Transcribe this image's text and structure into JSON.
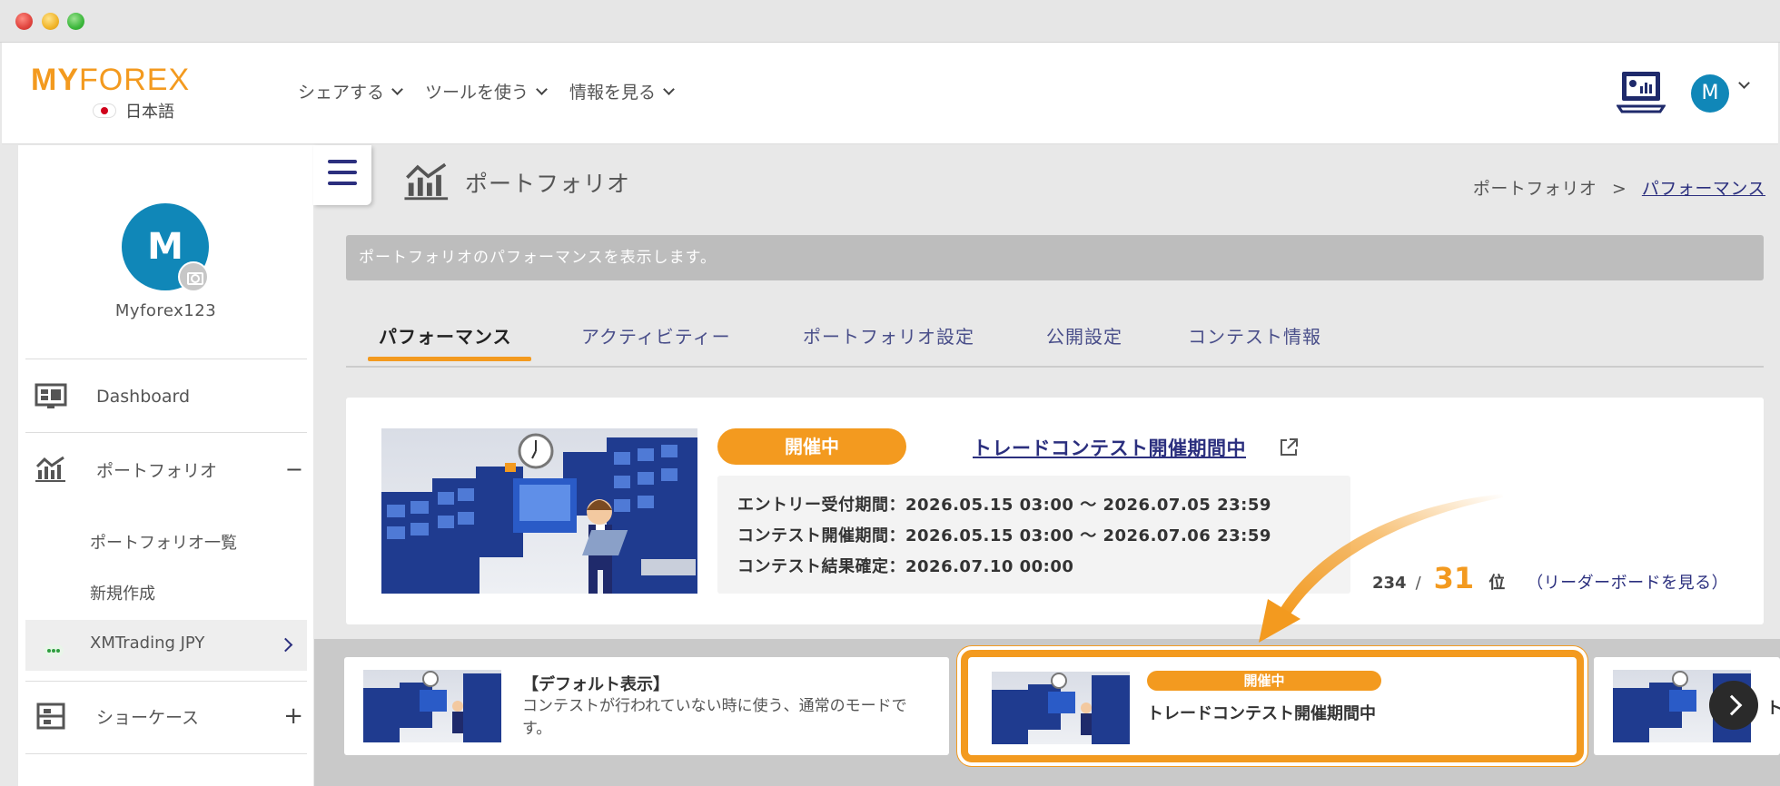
{
  "window": {
    "buttons": [
      "close",
      "minimize",
      "maximize"
    ]
  },
  "header": {
    "logo_my": "MY",
    "logo_forex": "FOREX",
    "language": "日本語",
    "nav": [
      {
        "label": "シェアする"
      },
      {
        "label": "ツールを使う"
      },
      {
        "label": "情報を見る"
      }
    ],
    "user_initial": "M"
  },
  "sidebar": {
    "avatar_initial": "M",
    "username": "Myforex123",
    "items": [
      {
        "label": "Dashboard",
        "icon": "dashboard-icon"
      },
      {
        "label": "ポートフォリオ",
        "icon": "portfolio-chart-icon",
        "toggle": "−"
      },
      {
        "label": "ショーケース",
        "icon": "showcase-icon",
        "toggle": "+"
      }
    ],
    "portfolio_sub": [
      {
        "label": "ポートフォリオ一覧"
      },
      {
        "label": "新規作成"
      },
      {
        "label": "XMTrading JPY"
      }
    ]
  },
  "page": {
    "title": "ポートフォリオ",
    "breadcrumb_root": "ポートフォリオ",
    "breadcrumb_sep": ">",
    "breadcrumb_current": "パフォーマンス",
    "info": "ポートフォリオのパフォーマンスを表示します。"
  },
  "tabs": [
    {
      "label": "パフォーマンス",
      "active": true
    },
    {
      "label": "アクティビティー"
    },
    {
      "label": "ポートフォリオ設定"
    },
    {
      "label": "公開設定"
    },
    {
      "label": "コンテスト情報"
    }
  ],
  "contest": {
    "status_badge": "開催中",
    "title": "トレードコンテスト開催期間中",
    "entry_period": "エントリー受付期間：2026.05.15 03:00 〜 2026.07.05 23:59",
    "contest_period": "コンテスト開催期間：2026.05.15 03:00 〜 2026.07.06 23:59",
    "result_date": "コンテスト結果確定：2026.07.10 00:00",
    "rank_total": "234",
    "rank_slash": "/",
    "rank": "31",
    "rank_unit": "位",
    "leaderboard": "（リーダーボードを見る）"
  },
  "modes": [
    {
      "title": "【デフォルト表示】",
      "text": "コンテストが行われていない時に使う、通常のモードです。"
    },
    {
      "badge": "開催中",
      "title": "トレードコンテスト開催期間中"
    },
    {
      "title": "ト"
    }
  ],
  "colors": {
    "accent": "#f39a1f",
    "navy": "#2b2f7e",
    "avatar": "#1087b8"
  }
}
